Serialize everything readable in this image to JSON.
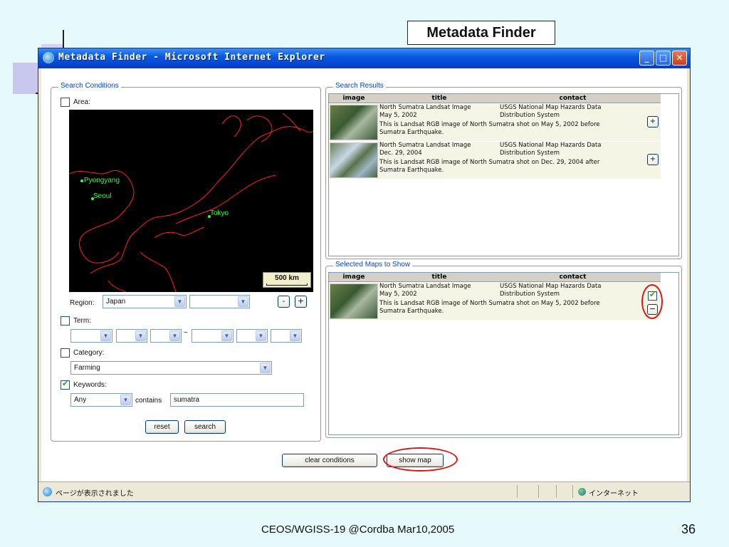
{
  "slide": {
    "title": "Metadata Finder",
    "footer": "CEOS/WGISS-19 @Cordba Mar10,2005",
    "page_number": "36"
  },
  "window": {
    "title": "Metadata Finder - Microsoft Internet Explorer",
    "min_label": "_",
    "max_label": "□",
    "close_label": "✕"
  },
  "search_conditions": {
    "legend": "Search Conditions",
    "area_label": "Area:",
    "area_checked": false,
    "map_labels": {
      "pyongyang": "Pyongyang",
      "seoul": "Seoul",
      "tokyo": "Tokyo"
    },
    "scale_label": "500 km",
    "region_label": "Region:",
    "region_value": "Japan",
    "region_sub_value": "",
    "zoom_out": "-",
    "zoom_in": "+",
    "term_label": "Term:",
    "term_checked": false,
    "term_separator": "~",
    "category_label": "Category:",
    "category_checked": false,
    "category_value": "Farming",
    "keywords_label": "Keywords:",
    "keywords_checked": true,
    "keywords_mode": "Any",
    "contains_label": "contains",
    "keywords_value": "sumatra",
    "reset_label": "reset",
    "search_label": "search"
  },
  "search_results": {
    "legend": "Search Results",
    "columns": [
      "image",
      "title",
      "contact"
    ],
    "rows": [
      {
        "title": "North Sumatra Landsat Image",
        "date": "May 5, 2002",
        "contact1": "USGS National Map Hazards Data",
        "contact2": "Distribution System",
        "desc1": "This is Landsat RGB image of North Sumatra shot on May 5, 2002 before",
        "desc2": "Sumatra Earthquake.",
        "action": "+"
      },
      {
        "title": "North Sumatra Landsat Image",
        "date": "Dec. 29, 2004",
        "contact1": "USGS National Map Hazards Data",
        "contact2": "Distribution System",
        "desc1": "This is Landsat RGB image of North Sumatra shot on Dec. 29, 2004 after",
        "desc2": "Sumatra Earthquake.",
        "action": "+"
      }
    ]
  },
  "selected_maps": {
    "legend": "Selected Maps to Show",
    "columns": [
      "image",
      "title",
      "contact"
    ],
    "rows": [
      {
        "title": "North Sumatra Landsat Image",
        "date": "May 5, 2002",
        "contact1": "USGS National Map Hazards Data",
        "contact2": "Distribution System",
        "desc1": "This is Landsat RGB image of North Sumatra shot on May 5, 2002 before",
        "desc2": "Sumatra Earthquake.",
        "shown": true,
        "remove": "−"
      }
    ]
  },
  "bottom_buttons": {
    "clear_label": "clear conditions",
    "show_map_label": "show map"
  },
  "statusbar": {
    "text": "ページが表示されました",
    "zone": "インターネット"
  },
  "colors": {
    "accent": "#0046d5",
    "highlight": "#d81818",
    "map_coast": "#ff2020",
    "map_city": "#33ff33"
  }
}
